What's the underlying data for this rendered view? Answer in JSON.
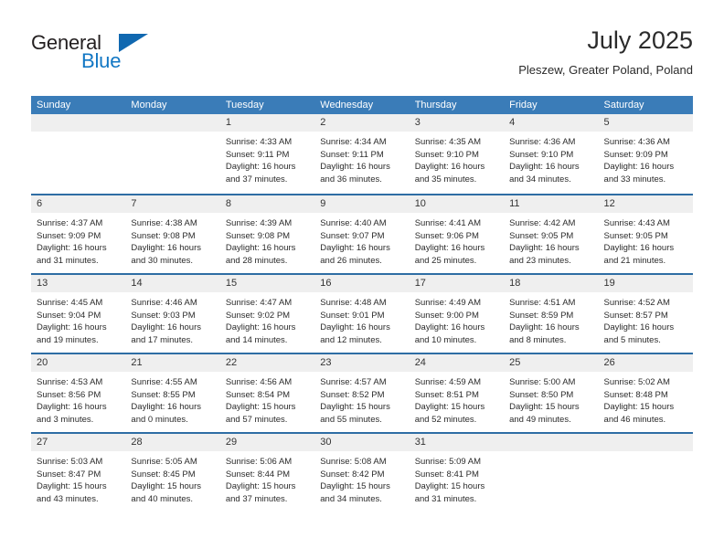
{
  "logo": {
    "word_primary": "General",
    "word_secondary": "Blue",
    "color_primary": "#231f20",
    "color_secondary": "#1277c4",
    "triangle_color": "#1068b0"
  },
  "header": {
    "title": "July 2025",
    "location": "Pleszew, Greater Poland, Poland"
  },
  "theme": {
    "header_blue": "#3a7cb8",
    "row_divider_blue": "#2e6da4",
    "day_band_gray": "#efefef"
  },
  "weekdays": [
    "Sunday",
    "Monday",
    "Tuesday",
    "Wednesday",
    "Thursday",
    "Friday",
    "Saturday"
  ],
  "weeks": [
    [
      {
        "day": "",
        "empty": true
      },
      {
        "day": "",
        "empty": true
      },
      {
        "day": "1",
        "sunrise": "Sunrise: 4:33 AM",
        "sunset": "Sunset: 9:11 PM",
        "daylight": "Daylight: 16 hours and 37 minutes."
      },
      {
        "day": "2",
        "sunrise": "Sunrise: 4:34 AM",
        "sunset": "Sunset: 9:11 PM",
        "daylight": "Daylight: 16 hours and 36 minutes."
      },
      {
        "day": "3",
        "sunrise": "Sunrise: 4:35 AM",
        "sunset": "Sunset: 9:10 PM",
        "daylight": "Daylight: 16 hours and 35 minutes."
      },
      {
        "day": "4",
        "sunrise": "Sunrise: 4:36 AM",
        "sunset": "Sunset: 9:10 PM",
        "daylight": "Daylight: 16 hours and 34 minutes."
      },
      {
        "day": "5",
        "sunrise": "Sunrise: 4:36 AM",
        "sunset": "Sunset: 9:09 PM",
        "daylight": "Daylight: 16 hours and 33 minutes."
      }
    ],
    [
      {
        "day": "6",
        "sunrise": "Sunrise: 4:37 AM",
        "sunset": "Sunset: 9:09 PM",
        "daylight": "Daylight: 16 hours and 31 minutes."
      },
      {
        "day": "7",
        "sunrise": "Sunrise: 4:38 AM",
        "sunset": "Sunset: 9:08 PM",
        "daylight": "Daylight: 16 hours and 30 minutes."
      },
      {
        "day": "8",
        "sunrise": "Sunrise: 4:39 AM",
        "sunset": "Sunset: 9:08 PM",
        "daylight": "Daylight: 16 hours and 28 minutes."
      },
      {
        "day": "9",
        "sunrise": "Sunrise: 4:40 AM",
        "sunset": "Sunset: 9:07 PM",
        "daylight": "Daylight: 16 hours and 26 minutes."
      },
      {
        "day": "10",
        "sunrise": "Sunrise: 4:41 AM",
        "sunset": "Sunset: 9:06 PM",
        "daylight": "Daylight: 16 hours and 25 minutes."
      },
      {
        "day": "11",
        "sunrise": "Sunrise: 4:42 AM",
        "sunset": "Sunset: 9:05 PM",
        "daylight": "Daylight: 16 hours and 23 minutes."
      },
      {
        "day": "12",
        "sunrise": "Sunrise: 4:43 AM",
        "sunset": "Sunset: 9:05 PM",
        "daylight": "Daylight: 16 hours and 21 minutes."
      }
    ],
    [
      {
        "day": "13",
        "sunrise": "Sunrise: 4:45 AM",
        "sunset": "Sunset: 9:04 PM",
        "daylight": "Daylight: 16 hours and 19 minutes."
      },
      {
        "day": "14",
        "sunrise": "Sunrise: 4:46 AM",
        "sunset": "Sunset: 9:03 PM",
        "daylight": "Daylight: 16 hours and 17 minutes."
      },
      {
        "day": "15",
        "sunrise": "Sunrise: 4:47 AM",
        "sunset": "Sunset: 9:02 PM",
        "daylight": "Daylight: 16 hours and 14 minutes."
      },
      {
        "day": "16",
        "sunrise": "Sunrise: 4:48 AM",
        "sunset": "Sunset: 9:01 PM",
        "daylight": "Daylight: 16 hours and 12 minutes."
      },
      {
        "day": "17",
        "sunrise": "Sunrise: 4:49 AM",
        "sunset": "Sunset: 9:00 PM",
        "daylight": "Daylight: 16 hours and 10 minutes."
      },
      {
        "day": "18",
        "sunrise": "Sunrise: 4:51 AM",
        "sunset": "Sunset: 8:59 PM",
        "daylight": "Daylight: 16 hours and 8 minutes."
      },
      {
        "day": "19",
        "sunrise": "Sunrise: 4:52 AM",
        "sunset": "Sunset: 8:57 PM",
        "daylight": "Daylight: 16 hours and 5 minutes."
      }
    ],
    [
      {
        "day": "20",
        "sunrise": "Sunrise: 4:53 AM",
        "sunset": "Sunset: 8:56 PM",
        "daylight": "Daylight: 16 hours and 3 minutes."
      },
      {
        "day": "21",
        "sunrise": "Sunrise: 4:55 AM",
        "sunset": "Sunset: 8:55 PM",
        "daylight": "Daylight: 16 hours and 0 minutes."
      },
      {
        "day": "22",
        "sunrise": "Sunrise: 4:56 AM",
        "sunset": "Sunset: 8:54 PM",
        "daylight": "Daylight: 15 hours and 57 minutes."
      },
      {
        "day": "23",
        "sunrise": "Sunrise: 4:57 AM",
        "sunset": "Sunset: 8:52 PM",
        "daylight": "Daylight: 15 hours and 55 minutes."
      },
      {
        "day": "24",
        "sunrise": "Sunrise: 4:59 AM",
        "sunset": "Sunset: 8:51 PM",
        "daylight": "Daylight: 15 hours and 52 minutes."
      },
      {
        "day": "25",
        "sunrise": "Sunrise: 5:00 AM",
        "sunset": "Sunset: 8:50 PM",
        "daylight": "Daylight: 15 hours and 49 minutes."
      },
      {
        "day": "26",
        "sunrise": "Sunrise: 5:02 AM",
        "sunset": "Sunset: 8:48 PM",
        "daylight": "Daylight: 15 hours and 46 minutes."
      }
    ],
    [
      {
        "day": "27",
        "sunrise": "Sunrise: 5:03 AM",
        "sunset": "Sunset: 8:47 PM",
        "daylight": "Daylight: 15 hours and 43 minutes."
      },
      {
        "day": "28",
        "sunrise": "Sunrise: 5:05 AM",
        "sunset": "Sunset: 8:45 PM",
        "daylight": "Daylight: 15 hours and 40 minutes."
      },
      {
        "day": "29",
        "sunrise": "Sunrise: 5:06 AM",
        "sunset": "Sunset: 8:44 PM",
        "daylight": "Daylight: 15 hours and 37 minutes."
      },
      {
        "day": "30",
        "sunrise": "Sunrise: 5:08 AM",
        "sunset": "Sunset: 8:42 PM",
        "daylight": "Daylight: 15 hours and 34 minutes."
      },
      {
        "day": "31",
        "sunrise": "Sunrise: 5:09 AM",
        "sunset": "Sunset: 8:41 PM",
        "daylight": "Daylight: 15 hours and 31 minutes."
      },
      {
        "day": "",
        "empty": true
      },
      {
        "day": "",
        "empty": true
      }
    ]
  ]
}
